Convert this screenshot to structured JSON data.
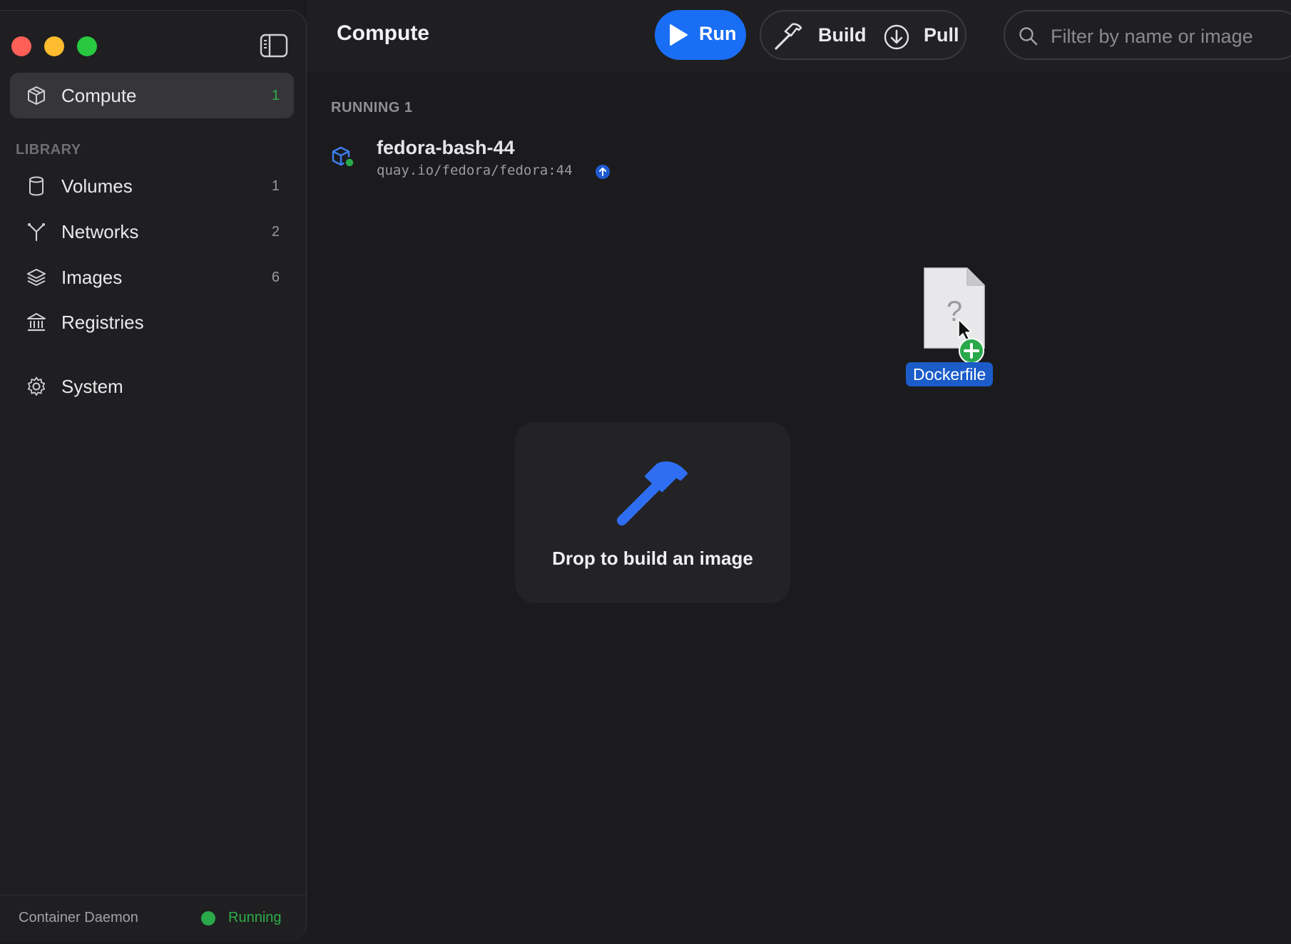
{
  "sidebar": {
    "primary": {
      "label": "Compute",
      "count": "1"
    },
    "section_label": "LIBRARY",
    "items": [
      {
        "label": "Volumes",
        "count": "1",
        "icon": "cylinder-icon"
      },
      {
        "label": "Networks",
        "count": "2",
        "icon": "network-fork-icon"
      },
      {
        "label": "Images",
        "count": "6",
        "icon": "layers-icon"
      },
      {
        "label": "Registries",
        "count": "",
        "icon": "bank-icon"
      }
    ],
    "system": {
      "label": "System"
    },
    "footer": {
      "label": "Container Daemon",
      "status": "Running"
    }
  },
  "toolbar": {
    "title": "Compute",
    "run_label": "Run",
    "build_label": "Build",
    "pull_label": "Pull",
    "search_placeholder": "Filter by name or image"
  },
  "content": {
    "running_label": "RUNNING 1",
    "containers": [
      {
        "name": "fedora-bash-44",
        "image": "quay.io/fedora/fedora:44",
        "status": "running"
      }
    ],
    "drop_zone_text": "Drop to build an image",
    "dragged_file_label": "Dockerfile"
  },
  "colors": {
    "accent": "#1a6ef5",
    "running_green": "#2aa94a",
    "background": "#1b1b1d",
    "sidebar_bg": "#1f1f21"
  }
}
